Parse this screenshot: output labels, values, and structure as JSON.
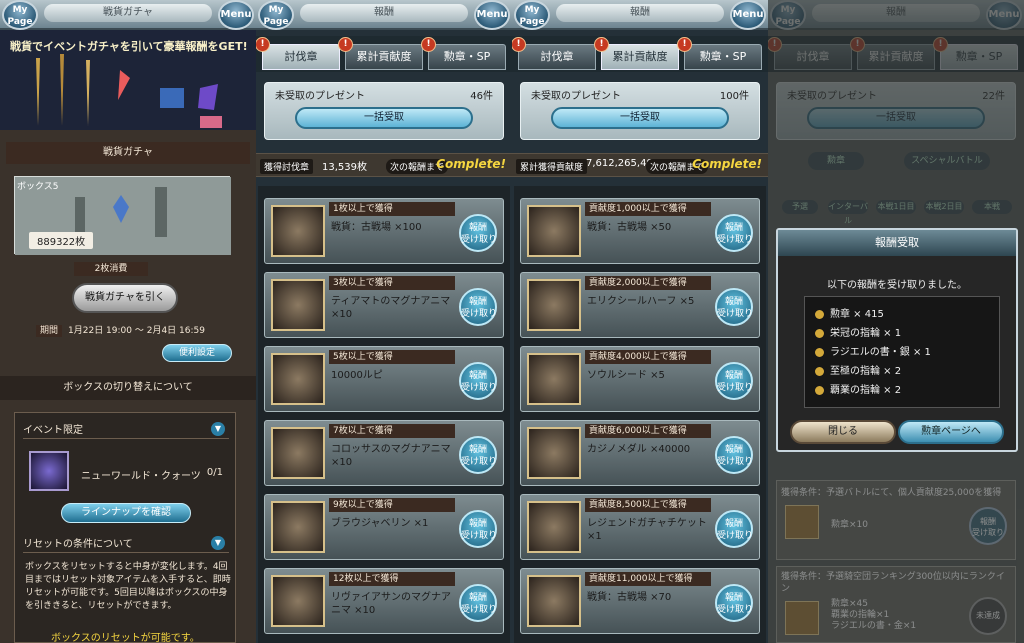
{
  "common": {
    "mypage": "My\nPage",
    "menu": "Menu",
    "alert": "!"
  },
  "p1": {
    "title": "戦貨ガチャ",
    "banner": "戦貨でイベントガチャを引いて豪華報酬をGET!",
    "gacha_header": "戦貨ガチャ",
    "box_name": "ボックス5",
    "coin_count": "889322枚",
    "cost": "2枚消費",
    "draw_button": "戦貨ガチャを引く",
    "period_label": "期間",
    "period_value": "1月22日 19:00 〜 2月4日 16:59",
    "settings_button": "便利設定",
    "switch_header": "ボックスの切り替えについて",
    "event_limited": "イベント限定",
    "crystal_name": "ニューワールド・クォーツ",
    "crystal_count": "0/1",
    "lineup_button": "ラインナップを確認",
    "reset_header": "リセットの条件について",
    "reset_text": "ボックスをリセットすると中身が変化します。4回目まではリセット対象アイテムを入手すると、即時リセットが可能です。5回目以降はボックスの中身を引ききると、リセットができます。",
    "reset_ok": "ボックスのリセットが可能です。"
  },
  "p2": {
    "title": "報酬",
    "tabs": [
      "討伐章",
      "累計貢献度",
      "勲章・SP"
    ],
    "present_label": "未受取のプレゼント",
    "present_count": "46件",
    "bulk_button": "一括受取",
    "stat_key": "獲得討伐章",
    "stat_value": "13,539枚",
    "next_label": "次の報酬まで",
    "complete": "Complete!",
    "claim_label": "報酬\n受け取り",
    "rows": [
      {
        "head": "1枚以上で獲得",
        "name": "戦貨：古戦場 ×100"
      },
      {
        "head": "3枚以上で獲得",
        "name": "ティアマトのマグナアニマ ×10"
      },
      {
        "head": "5枚以上で獲得",
        "name": "10000ルピ"
      },
      {
        "head": "7枚以上で獲得",
        "name": "コロッサスのマグナアニマ ×10"
      },
      {
        "head": "9枚以上で獲得",
        "name": "ブラウジャベリン ×1"
      },
      {
        "head": "12枚以上で獲得",
        "name": "リヴァイアサンのマグナアニマ ×10"
      }
    ]
  },
  "p3": {
    "title": "報酬",
    "tabs": [
      "討伐章",
      "累計貢献度",
      "勲章・SP"
    ],
    "present_label": "未受取のプレゼント",
    "present_count": "100件",
    "bulk_button": "一括受取",
    "stat_key": "累計獲得貢献度",
    "stat_value": "7,612,265,402",
    "next_label": "次の報酬まで",
    "complete": "Complete!",
    "claim_label": "報酬\n受け取り",
    "rows": [
      {
        "head": "貢献度1,000以上で獲得",
        "name": "戦貨：古戦場 ×50"
      },
      {
        "head": "貢献度2,000以上で獲得",
        "name": "エリクシールハーフ ×5"
      },
      {
        "head": "貢献度4,000以上で獲得",
        "name": "ソウルシード ×5"
      },
      {
        "head": "貢献度6,000以上で獲得",
        "name": "カジノメダル ×40000"
      },
      {
        "head": "貢献度8,500以上で獲得",
        "name": "レジェンドガチャチケット ×1"
      },
      {
        "head": "貢献度11,000以上で獲得",
        "name": "戦貨：古戦場 ×70"
      }
    ]
  },
  "p4": {
    "title": "報酬",
    "tabs": [
      "討伐章",
      "累計貢献度",
      "勲章・SP"
    ],
    "present_label": "未受取のプレゼント",
    "present_count": "22件",
    "bulk_button": "一括受取",
    "sub_tabs": [
      "勲章",
      "スペシャルバトル"
    ],
    "filter_tabs": [
      "予選",
      "インターバル",
      "本戦1日目",
      "本戦2日目",
      "本戦"
    ],
    "modal_title": "報酬受取",
    "modal_desc": "以下の報酬を受け取りました。",
    "modal_items": [
      "勲章 × 415",
      "栄冠の指輪 × 1",
      "ラジエルの書・銀 × 1",
      "至極の指輪 × 2",
      "覇業の指輪 × 2"
    ],
    "close_button": "閉じる",
    "goto_button": "勲章ページへ",
    "cond1": "獲得条件：予選バトルにて、個人貢献度25,000を獲得",
    "cond1_reward": "勲章×10",
    "cond2": "獲得条件：予選騎空団ランキング300位以内にランクイン",
    "cond2_reward": "勲章×45\n覇業の指輪×1\nラジエルの書・金×1",
    "claimed": "未達成",
    "claim_label": "報酬\n受け取り"
  }
}
